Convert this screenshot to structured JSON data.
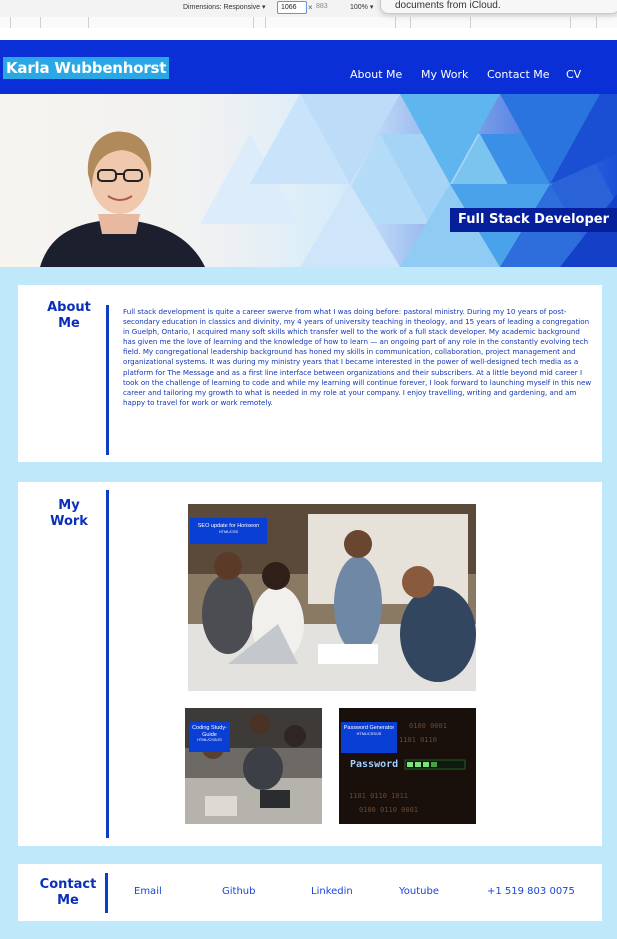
{
  "devtools": {
    "dimensions_label": "Dimensions: Responsive ▾",
    "width_value": "1066",
    "times": "×",
    "height_value": "883",
    "zoom": "100% ▾",
    "notification_text": "documents from iCloud."
  },
  "header": {
    "brand": "Karla Wubbenhorst",
    "nav": [
      "About Me",
      "My Work",
      "Contact Me",
      "CV"
    ]
  },
  "hero": {
    "title": "Full Stack Developer"
  },
  "about": {
    "heading_line1": "About",
    "heading_line2": "Me",
    "body": "Full stack development is quite a career swerve from what I was doing before: pastoral ministry. During my 10 years of post-secondary education in classics and divinity, my 4 years of university teaching in theology, and 15 years of leading a congregation in Guelph, Ontario, I acquired many soft skills which transfer well to the work of a full stack developer. My academic background has given me the love of learning and the knowledge of how to learn — an ongoing part of any role in the constantly evolving tech field. My congregational leadership background has honed my skills in communication, collaboration, project management and organizational systems. It was during my ministry years that I became interested in the power of well-designed tech media as a platform for The Message and as a first line interface between organizations and their subscribers. At a little beyond mid career I took on the challenge of learning to code and while my learning will continue forever, I look forward to launching myself in this new career and tailoring my growth to what is needed in my role at your company. I enjoy travelling, writing and gardening, and am happy to travel for work or work remotely."
  },
  "work": {
    "heading_line1": "My",
    "heading_line2": "Work",
    "projects": [
      {
        "title": "SEO update for Horiseon",
        "tech": "HTML/CSS"
      },
      {
        "title": "Coding Study-Guide",
        "tech": "HTML/CSS/JS"
      },
      {
        "title": "Password Generator",
        "tech": "HTML/CSS/JS"
      }
    ],
    "password_screen_text": "Password"
  },
  "contact": {
    "heading_line1": "Contact",
    "heading_line2": "Me",
    "links": [
      "Email",
      "Github",
      "Linkedin",
      "Youtube",
      "+1 519 803 0075"
    ]
  },
  "colors": {
    "header_blue": "#0a2fd6",
    "page_bg": "#bfe8fa",
    "accent_text": "#0a2fb8",
    "brand_bg": "#29a7e6"
  }
}
